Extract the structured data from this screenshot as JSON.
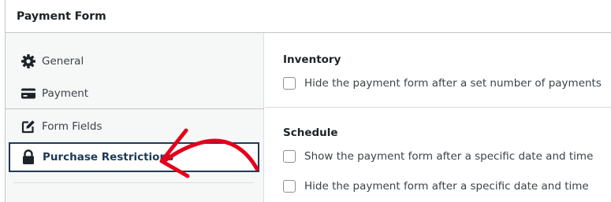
{
  "header": {
    "title": "Payment Form"
  },
  "sidebar": {
    "items": [
      {
        "label": "General",
        "icon": "gear-icon"
      },
      {
        "label": "Payment",
        "icon": "credit-card-icon"
      },
      {
        "label": "Form Fields",
        "icon": "edit-icon"
      },
      {
        "label": "Purchase Restrictions",
        "icon": "lock-icon",
        "active": true
      }
    ]
  },
  "main": {
    "inventory": {
      "title": "Inventory",
      "options": [
        {
          "label": "Hide the payment form after a set number of payments",
          "checked": false
        }
      ]
    },
    "schedule": {
      "title": "Schedule",
      "options": [
        {
          "label": "Show the payment form after a specific date and time",
          "checked": false
        },
        {
          "label": "Hide the payment form after a specific date and time",
          "checked": false
        }
      ]
    }
  },
  "colors": {
    "active_border": "#1d3a55",
    "annotation_arrow": "#e3001b"
  }
}
